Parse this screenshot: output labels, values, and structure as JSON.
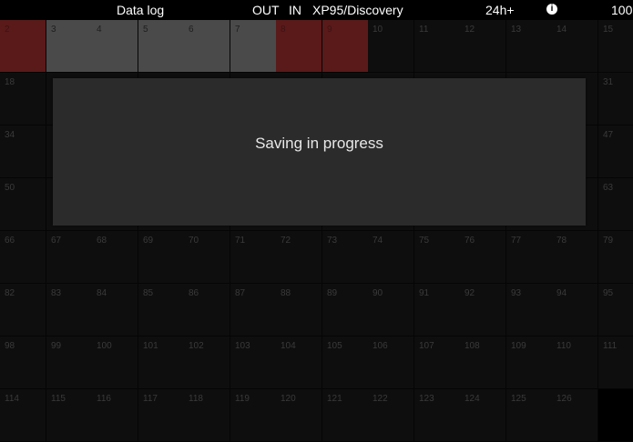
{
  "status_bar": {
    "title": "Data log",
    "out_label": "OUT",
    "in_label": "IN",
    "device": "XP95/Discovery",
    "duration": "24h+",
    "info_icon": "info-icon",
    "value": "100"
  },
  "grid": {
    "rows": [
      [
        "2",
        "3",
        "4",
        "5",
        "6",
        "7",
        "8",
        "9",
        "10",
        "11",
        "12",
        "13",
        "14",
        "15"
      ],
      [
        "18",
        "",
        "",
        "",
        "",
        "",
        "",
        "",
        "",
        "",
        "",
        "",
        "",
        "31"
      ],
      [
        "34",
        "",
        "",
        "",
        "",
        "",
        "",
        "",
        "",
        "",
        "",
        "",
        "",
        "47"
      ],
      [
        "50",
        "",
        "",
        "",
        "",
        "",
        "",
        "",
        "",
        "",
        "",
        "",
        "",
        "63"
      ],
      [
        "66",
        "67",
        "68",
        "69",
        "70",
        "71",
        "72",
        "73",
        "74",
        "75",
        "76",
        "77",
        "78",
        "79"
      ],
      [
        "82",
        "83",
        "84",
        "85",
        "86",
        "87",
        "88",
        "89",
        "90",
        "91",
        "92",
        "93",
        "94",
        "95"
      ],
      [
        "98",
        "99",
        "100",
        "101",
        "102",
        "103",
        "104",
        "105",
        "106",
        "107",
        "108",
        "109",
        "110",
        "111"
      ],
      [
        "114",
        "115",
        "116",
        "117",
        "118",
        "119",
        "120",
        "121",
        "122",
        "123",
        "124",
        "125",
        "126",
        ""
      ]
    ],
    "red_cells": [
      "2",
      "8",
      "9"
    ],
    "gray_cells": [
      "3",
      "4",
      "5",
      "6",
      "7"
    ],
    "colors": {
      "red": "#5a1a1a",
      "gray": "#4a4a4a",
      "cell": "#0e0e0e"
    }
  },
  "dialog": {
    "message": "Saving in progress"
  }
}
